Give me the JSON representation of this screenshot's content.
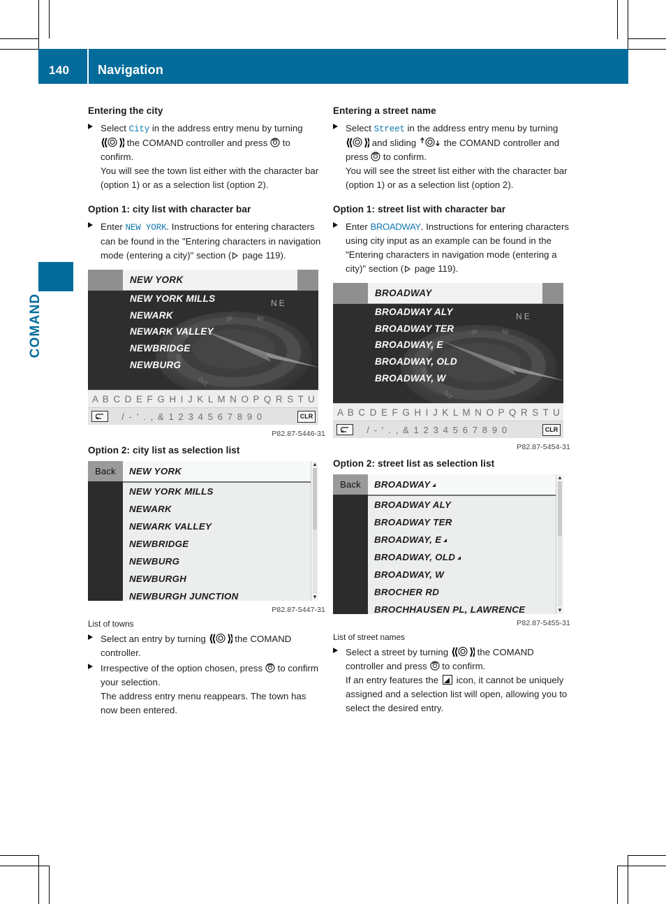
{
  "header": {
    "page_number": "140",
    "chapter_title": "Navigation",
    "accent_color": "#036c9b"
  },
  "side_tab": {
    "label": "COMAND"
  },
  "left_column": {
    "heading_1": "Entering the city",
    "step_1_pre": "Select ",
    "step_1_code": "City",
    "step_1_mid": " in the address entry menu by turning ",
    "step_1_mid2": " the COMAND controller and press ",
    "step_1_end": " to confirm.",
    "step_1_note": "You will see the town list either with the character bar (option 1) or as a selection list (option 2).",
    "heading_2": "Option 1: city list with character bar",
    "step_2_pre": "Enter ",
    "step_2_code": "NEW YORK",
    "step_2_post": ". Instructions for entering characters can be found in the \"Entering characters in navigation mode (entering a city)\" section (",
    "step_2_page": " page 119).",
    "figure_1": {
      "fig_number": "P82.87-5446-31",
      "selected_item": "NEW YORK",
      "items": [
        "NEW YORK MILLS",
        "NEWARK",
        "NEWARK VALLEY",
        "NEWBRIDGE",
        "NEWBURG"
      ],
      "character_bar": "A B C D E F G H I J K L M N O P Q R S T U V W X Y Z _",
      "number_bar": "/ - ' . , & 1 2 3 4 5 6 7 8 9 0",
      "ok_label": "ok",
      "clr_label": "CLR"
    },
    "heading_3": "Option 2: city list as selection list",
    "figure_2": {
      "fig_number": "P82.87-5447-31",
      "back_label": "Back",
      "selected_item": "NEW YORK",
      "items": [
        "NEW YORK MILLS",
        "NEWARK",
        "NEWARK VALLEY",
        "NEWBRIDGE",
        "NEWBURG",
        "NEWBURGH",
        "NEWBURGH JUNCTION"
      ]
    },
    "caption_1": "List of towns",
    "step_3_pre": "Select an entry by turning ",
    "step_3_post": " the COMAND controller.",
    "step_4_pre": "Irrespective of the option chosen, press ",
    "step_4_post": " to confirm your selection.",
    "step_4_note": "The address entry menu reappears. The town has now been entered."
  },
  "right_column": {
    "heading_1": "Entering a street name",
    "step_1_pre": "Select ",
    "step_1_code": "Street",
    "step_1_mid": " in the address entry menu by turning ",
    "step_1_mid2": " and sliding ",
    "step_1_mid3": " the COMAND controller and press ",
    "step_1_end": " to confirm.",
    "step_1_note": "You will see the street list either with the character bar (option 1) or as a selection list (option 2).",
    "heading_2": "Option 1: street list with character bar",
    "step_2_pre": "Enter ",
    "step_2_code": "BROADWAY",
    "step_2_post": ". Instructions for entering characters using city input as an example can be found in the \"Entering characters in navigation mode (entering a city)\" section (",
    "step_2_page": " page 119).",
    "figure_1": {
      "fig_number": "P82.87-5454-31",
      "selected_item": "BROADWAY",
      "items": [
        "BROADWAY ALY",
        "BROADWAY TER",
        "BROADWAY, E",
        "BROADWAY, OLD",
        "BROADWAY, W"
      ],
      "character_bar": "A B C D E F G H I J K L M N O P Q R S T U V W X Y Z _",
      "number_bar": "/ - ' . , & 1 2 3 4 5 6 7 8 9 0",
      "ok_label": "ok",
      "clr_label": "CLR"
    },
    "heading_3": "Option 2: street list as selection list",
    "figure_2": {
      "fig_number": "P82.87-5455-31",
      "back_label": "Back",
      "selected_item": "BROADWAY",
      "selected_has_icon": true,
      "items": [
        {
          "text": "BROADWAY ALY",
          "icon": false
        },
        {
          "text": "BROADWAY TER",
          "icon": false
        },
        {
          "text": "BROADWAY, E",
          "icon": true
        },
        {
          "text": "BROADWAY, OLD",
          "icon": true
        },
        {
          "text": "BROADWAY, W",
          "icon": false
        },
        {
          "text": "BROCHER RD",
          "icon": false
        },
        {
          "text": "BROCHHAUSEN PL, LAWRENCE",
          "icon": false
        }
      ]
    },
    "caption_1": "List of street names",
    "step_3_pre": "Select a street by turning ",
    "step_3_mid": " the COMAND controller and press ",
    "step_3_end": " to confirm.",
    "step_3_note_a": "If an entry features the ",
    "step_3_note_b": " icon, it cannot be uniquely assigned and a selection list will open, allowing you to select the desired entry."
  }
}
